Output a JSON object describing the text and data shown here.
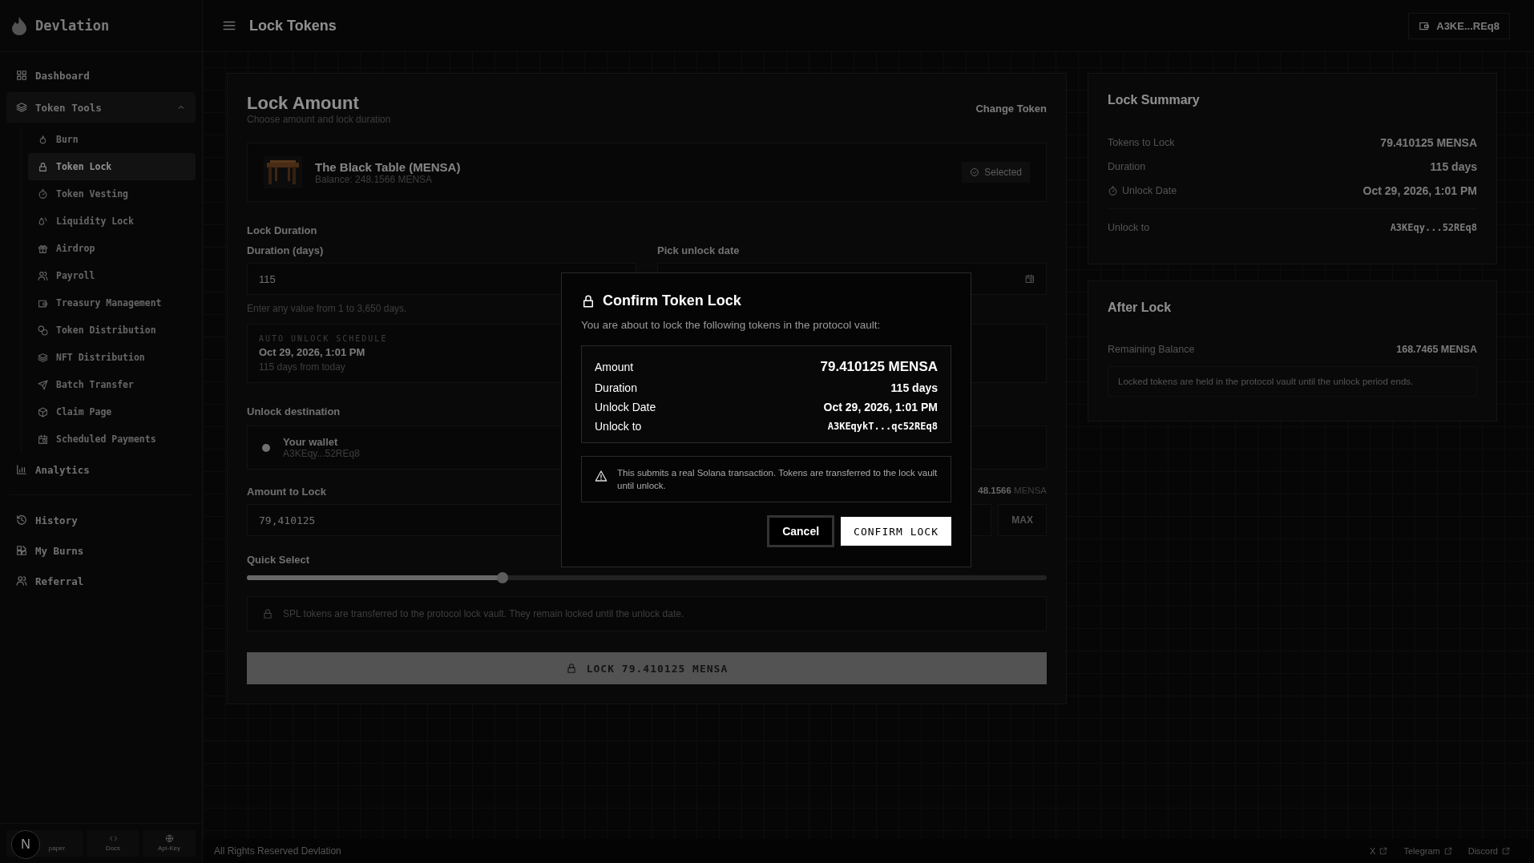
{
  "sidebar": {
    "brand": "Devlation",
    "nav_top": [
      {
        "label": "Dashboard",
        "selected": false
      }
    ],
    "token_tools": {
      "label": "Token Tools",
      "expanded": true,
      "items": [
        {
          "label": "Burn",
          "selected": false
        },
        {
          "label": "Token Lock",
          "selected": true
        },
        {
          "label": "Token Vesting",
          "selected": false
        },
        {
          "label": "Liquidity Lock",
          "selected": false
        },
        {
          "label": "Airdrop",
          "selected": false
        },
        {
          "label": "Payroll",
          "selected": false
        },
        {
          "label": "Treasury Management",
          "selected": false
        },
        {
          "label": "Token Distribution",
          "selected": false
        },
        {
          "label": "NFT Distribution",
          "selected": false
        },
        {
          "label": "Batch Transfer",
          "selected": false
        },
        {
          "label": "Claim Page",
          "selected": false
        },
        {
          "label": "Scheduled Payments",
          "selected": false
        }
      ]
    },
    "nav_after": [
      {
        "label": "Analytics",
        "selected": false
      }
    ],
    "nav_bottom": [
      {
        "label": "History",
        "selected": false
      },
      {
        "label": "My Burns",
        "selected": false
      },
      {
        "label": "Referral",
        "selected": false
      }
    ],
    "footer_links": [
      "paper",
      "Docs",
      "Api-Key"
    ],
    "dev_badge": "N"
  },
  "topbar": {
    "title": "Lock Tokens",
    "wallet": "A3KE...REq8"
  },
  "lock_amount": {
    "title": "Lock Amount",
    "subtitle": "Choose amount and lock duration",
    "change_token": "Change Token",
    "token": {
      "name": "The Black Table (MENSA)",
      "balance": "Balance: 248.1566 MENSA",
      "badge": "Selected"
    },
    "duration_heading": "Lock Duration",
    "duration_label": "Duration (days)",
    "duration_value": "115",
    "date_label": "Pick unlock date",
    "duration_hint": "Enter any value from 1 to 3,650 days.",
    "schedule": {
      "label": "AUTO UNLOCK SCHEDULE",
      "date": "Oct 29, 2026, 1:01 PM",
      "note": "115 days from today"
    },
    "destination_heading": "Unlock destination",
    "destinations": [
      {
        "label": "Your wallet",
        "address": "A3KEqy...52REq8",
        "selected": true
      }
    ],
    "amount_label": "Amount to Lock",
    "balance_value": "48.1566",
    "balance_unit": "MENSA",
    "amount_value": "79,410125",
    "max": "MAX",
    "quick_select": {
      "label": "Quick Select",
      "level": 0.32
    },
    "info": "SPL tokens are transferred to the protocol lock vault. They remain locked until the unlock date.",
    "submit": "LOCK 79.410125 MENSA"
  },
  "lock_summary": {
    "title": "Lock Summary",
    "rows": [
      {
        "label": "Tokens to Lock",
        "value": "79.410125 MENSA",
        "kind": "plain"
      },
      {
        "label": "Duration",
        "value": "115 days",
        "kind": "plain"
      },
      {
        "label": "Unlock Date",
        "value": "Oct 29, 2026, 1:01 PM",
        "kind": "timer"
      },
      {
        "label": "Unlock to",
        "value": "A3KEqy...52REq8",
        "kind": "address"
      }
    ]
  },
  "after_lock": {
    "title": "After Lock",
    "label": "Remaining Balance",
    "value": "168.7465 MENSA",
    "note": "Locked tokens are held in the protocol vault until the unlock period ends."
  },
  "footer": {
    "copyright": "All Rights Reserved Devlation",
    "links": [
      "X",
      "Telegram",
      "Discord"
    ]
  },
  "dialog": {
    "title": "Confirm Token Lock",
    "intro": "You are about to lock the following tokens in the protocol vault:",
    "rows": [
      {
        "label": "Amount",
        "value": "79.410125 MENSA",
        "kind": "large"
      },
      {
        "label": "Duration",
        "value": "115 days",
        "kind": "plain"
      },
      {
        "label": "Unlock Date",
        "value": "Oct 29, 2026, 1:01 PM",
        "kind": "plain"
      },
      {
        "label": "Unlock to",
        "value": "A3KEqykT...qc52REq8",
        "kind": "address"
      }
    ],
    "warning": "This submits a real Solana transaction. Tokens are transferred to the lock vault until unlock.",
    "cancel": "Cancel",
    "confirm": "CONFIRM LOCK"
  }
}
